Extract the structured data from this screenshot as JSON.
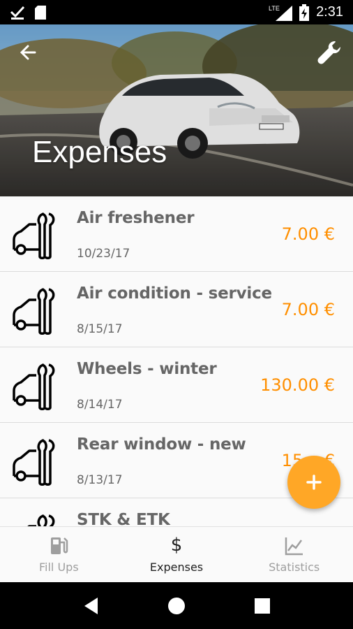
{
  "status_bar": {
    "time": "2:31",
    "network": "LTE"
  },
  "header": {
    "title": "Expenses",
    "back_icon": "arrow-back-icon",
    "settings_icon": "wrench-icon"
  },
  "expenses": [
    {
      "title": "Air freshener",
      "date": "10/23/17",
      "amount": "7.00 €"
    },
    {
      "title": "Air condition - service",
      "date": "8/15/17",
      "amount": "7.00 €"
    },
    {
      "title": "Wheels - winter",
      "date": "8/14/17",
      "amount": "130.00 €"
    },
    {
      "title": "Rear window - new",
      "date": "8/13/17",
      "amount": "15... €"
    },
    {
      "title": "STK & ETK",
      "date": "",
      "amount": ""
    }
  ],
  "fab": {
    "label": "+"
  },
  "bottom_nav": [
    {
      "label": "Fill Ups",
      "icon": "fuel-pump-icon",
      "active": false
    },
    {
      "label": "Expenses",
      "icon": "dollar-icon",
      "active": true
    },
    {
      "label": "Statistics",
      "icon": "chart-icon",
      "active": false
    }
  ],
  "colors": {
    "accent": "#ff8f00",
    "fab": "#ffa726",
    "text": "#666666"
  }
}
